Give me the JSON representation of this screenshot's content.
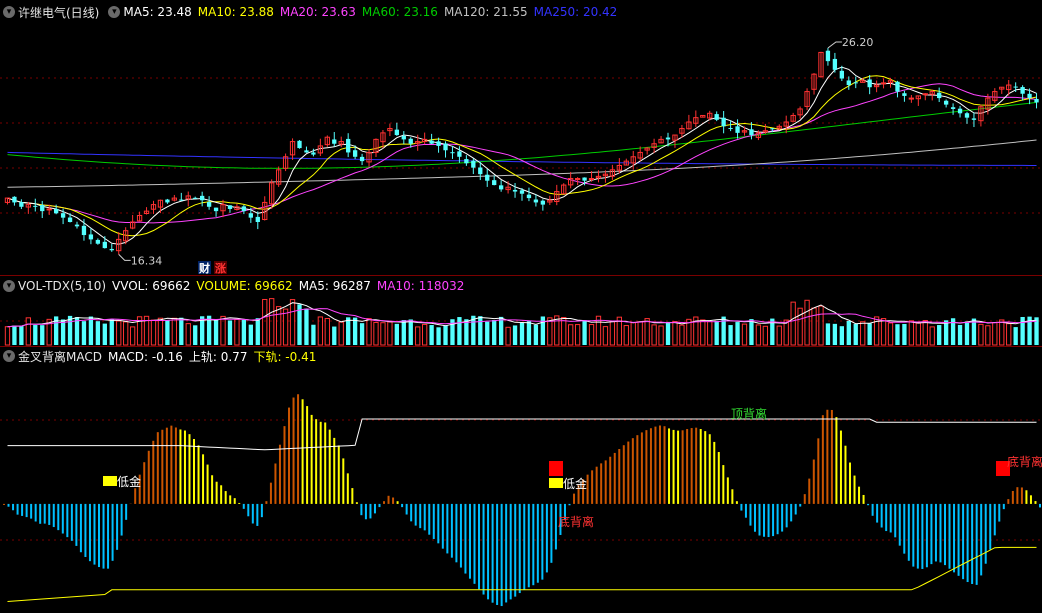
{
  "colors": {
    "bg": "#000000",
    "up": "#ff3232",
    "down": "#54ffff",
    "grid": "#7a0000",
    "ma5": "#ffffff",
    "ma10": "#ffff00",
    "ma20": "#ff44ff",
    "ma60": "#00cc00",
    "ma120": "#c0c0c0",
    "ma250": "#3333ff",
    "vma5": "#ffffff",
    "vma10": "#ff44ff",
    "macd_up": "#ffff00",
    "macd_up_weak": "#cc5500",
    "macd_dn": "#00c0ff",
    "upper_line": "#ffffff",
    "lower_line": "#ffff00"
  },
  "price_panel": {
    "stock_name": "许继电气(日线)",
    "indicators": [
      {
        "label": "MA5: 23.48",
        "color": "#ffffff"
      },
      {
        "label": "MA10: 23.88",
        "color": "#ffff00"
      },
      {
        "label": "MA20: 23.63",
        "color": "#ff44ff"
      },
      {
        "label": "MA60: 23.16",
        "color": "#00cc00"
      },
      {
        "label": "MA120: 21.55",
        "color": "#c0c0c0"
      },
      {
        "label": "MA250: 20.42",
        "color": "#3333ff"
      }
    ],
    "high_label": "26.20",
    "low_label": "16.34",
    "badge_cai": "财",
    "badge_zhang": "涨"
  },
  "volume_panel": {
    "name": "VOL-TDX(5,10)",
    "indicators": [
      {
        "label": "VVOL: 69662",
        "color": "#ffffff"
      },
      {
        "label": "VOLUME: 69662",
        "color": "#ffff00"
      },
      {
        "label": "MA5: 96287",
        "color": "#ffffff"
      },
      {
        "label": "MA10: 118032",
        "color": "#ff44ff"
      }
    ]
  },
  "macd_panel": {
    "name": "金叉背离MACD",
    "indicators": [
      {
        "label": "MACD: -0.16",
        "color": "#ffffff"
      },
      {
        "label": "上轨: 0.77",
        "color": "#ffffff"
      },
      {
        "label": "下轨: -0.41",
        "color": "#ffff00"
      }
    ],
    "annotations": {
      "dijin1": "低金",
      "dijin2": "低金",
      "dibeili": "底背离",
      "dingbeili": "顶背离",
      "dibeili2": "底背离"
    }
  },
  "chart_data": {
    "type": "candlestick",
    "price_range": [
      15.5,
      27.0
    ],
    "high": 26.2,
    "low": 16.34,
    "closes": [
      18.9,
      18.7,
      18.5,
      18.6,
      18.5,
      18.3,
      18.4,
      18.2,
      18.0,
      17.8,
      17.6,
      17.2,
      17.0,
      16.8,
      16.6,
      16.5,
      17.0,
      17.4,
      17.8,
      18.1,
      18.3,
      18.6,
      18.8,
      18.7,
      18.9,
      18.8,
      19.0,
      18.9,
      18.8,
      18.5,
      18.3,
      18.6,
      18.4,
      18.5,
      18.3,
      18.0,
      17.8,
      18.7,
      19.6,
      20.2,
      20.8,
      21.5,
      21.2,
      21.0,
      20.9,
      21.3,
      21.7,
      21.4,
      21.5,
      21.0,
      20.8,
      20.6,
      21.0,
      21.6,
      21.9,
      22.1,
      21.8,
      21.6,
      21.4,
      21.5,
      21.6,
      21.4,
      21.3,
      21.1,
      21.0,
      20.8,
      20.5,
      20.3,
      20.0,
      19.7,
      19.5,
      19.3,
      19.4,
      19.2,
      19.1,
      18.9,
      18.7,
      18.6,
      18.8,
      19.2,
      19.5,
      19.8,
      19.8,
      19.7,
      19.8,
      19.9,
      20.0,
      20.2,
      20.4,
      20.6,
      20.8,
      21.0,
      21.2,
      21.4,
      21.6,
      21.6,
      21.8,
      22.1,
      22.4,
      22.6,
      22.7,
      22.8,
      22.5,
      22.2,
      22.1,
      21.9,
      22.0,
      21.8,
      21.9,
      22.0,
      22.1,
      22.2,
      22.4,
      22.7,
      23.0,
      23.8,
      24.6,
      25.6,
      25.2,
      24.8,
      24.4,
      24.1,
      24.2,
      24.3,
      24.0,
      24.1,
      24.2,
      24.3,
      23.8,
      23.6,
      23.5,
      23.6,
      23.7,
      23.8,
      23.5,
      23.2,
      23.0,
      22.8,
      22.6,
      22.5,
      23.1,
      23.5,
      23.8,
      24.0,
      24.1,
      24.0,
      23.7,
      23.5,
      23.3
    ],
    "volume_range": [
      0,
      250000
    ],
    "macd_range": [
      -1.0,
      1.3
    ],
    "upper_rail_last": 0.77,
    "lower_rail_last": -0.41
  }
}
